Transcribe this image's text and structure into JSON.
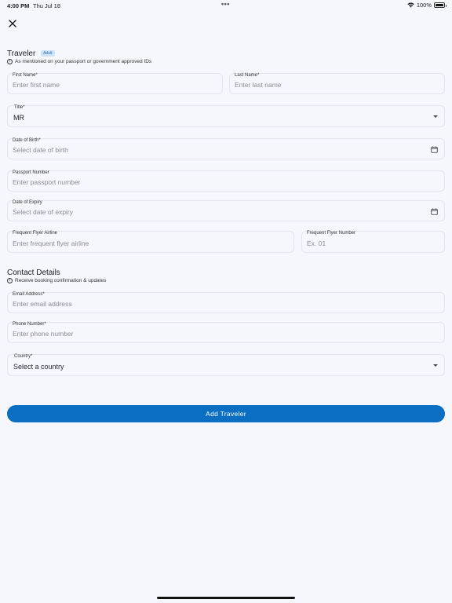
{
  "status": {
    "time": "4:00 PM",
    "date": "Thu Jul 18",
    "dots": "•••",
    "battery": "100%",
    "battery_level": 1.0
  },
  "colors": {
    "accent": "#0a6fc2",
    "badge_bg": "#cfe3f7",
    "background": "#f6f7fc"
  },
  "traveler": {
    "title": "Traveler",
    "badge": "Adult",
    "info": "As mentioned on your passport or government approved IDs",
    "first_name": {
      "label": "First Name*",
      "placeholder": "Enter first name"
    },
    "last_name": {
      "label": "Last Name*",
      "placeholder": "Enter last name"
    },
    "title_field": {
      "label": "Title*",
      "value": "MR"
    },
    "dob": {
      "label": "Date of Birth*",
      "placeholder": "Select date of birth"
    },
    "passport": {
      "label": "Passport Number",
      "placeholder": "Enter passport number"
    },
    "expiry": {
      "label": "Date of Expiry",
      "placeholder": "Select date of expiry"
    },
    "ff_airline": {
      "label": "Frequent Flyer Airline",
      "placeholder": "Enter frequent flyer airline"
    },
    "ff_number": {
      "label": "Frequent Flyer Number",
      "placeholder": "Ex. 01"
    }
  },
  "contact": {
    "title": "Contact Details",
    "info": "Receive booking confirmation & updates",
    "email": {
      "label": "Email Address*",
      "placeholder": "Enter email address"
    },
    "phone": {
      "label": "Phone Number*",
      "placeholder": "Enter phone number"
    },
    "country": {
      "label": "Country*",
      "value": "Select a country"
    }
  },
  "actions": {
    "add_traveler": "Add Traveler"
  }
}
